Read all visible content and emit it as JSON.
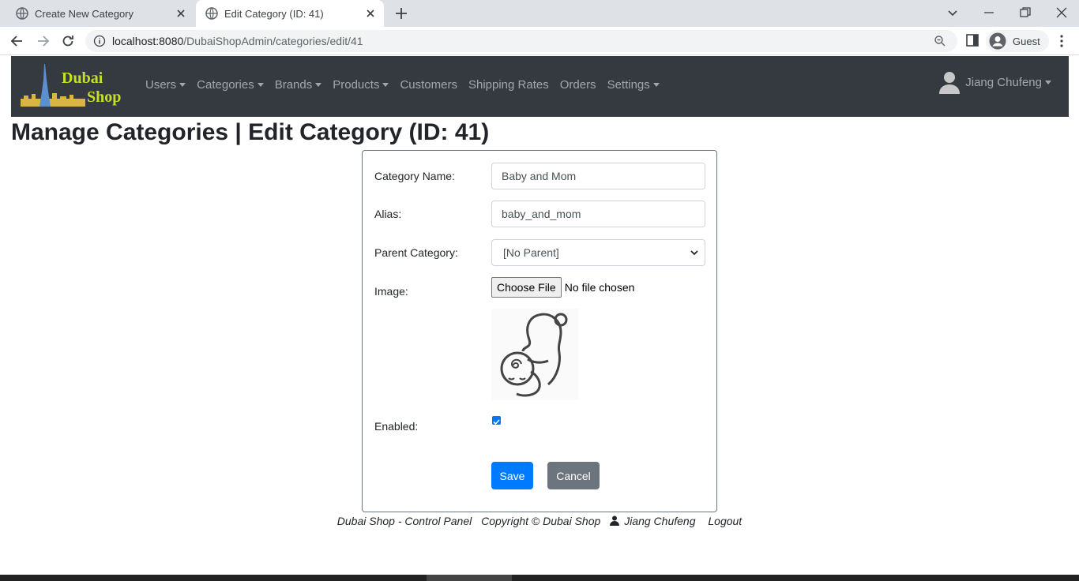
{
  "browser": {
    "tabs": [
      {
        "title": "Create New Category",
        "active": false
      },
      {
        "title": "Edit Category (ID: 41)",
        "active": true
      }
    ],
    "url_host": "localhost:8080",
    "url_path": "/DubaiShopAdmin/categories/edit/41",
    "profile_label": "Guest"
  },
  "brand": {
    "line1": "Dubai",
    "line2": "Shop"
  },
  "nav": {
    "items": [
      {
        "label": "Users",
        "dropdown": true
      },
      {
        "label": "Categories",
        "dropdown": true
      },
      {
        "label": "Brands",
        "dropdown": true
      },
      {
        "label": "Products",
        "dropdown": true
      },
      {
        "label": "Customers",
        "dropdown": false
      },
      {
        "label": "Shipping Rates",
        "dropdown": false
      },
      {
        "label": "Orders",
        "dropdown": false
      },
      {
        "label": "Settings",
        "dropdown": true
      }
    ],
    "user_name": "Jiang Chufeng"
  },
  "page_title": "Manage Categories | Edit Category (ID: 41)",
  "form": {
    "name_label": "Category Name:",
    "name_value": "Baby and Mom",
    "alias_label": "Alias:",
    "alias_value": "baby_and_mom",
    "parent_label": "Parent Category:",
    "parent_value": "[No Parent]",
    "image_label": "Image:",
    "choose_file": "Choose File",
    "no_file": "No file chosen",
    "enabled_label": "Enabled:",
    "enabled": true,
    "save": "Save",
    "cancel": "Cancel"
  },
  "footer": {
    "panel": "Dubai Shop - Control Panel",
    "copyright": "Copyright © Dubai Shop",
    "user": "Jiang Chufeng",
    "logout": "Logout"
  },
  "colors": {
    "navbar": "#343a40",
    "primary": "#007bff",
    "secondary": "#6c757d",
    "brand_text": "#c6e02a"
  }
}
